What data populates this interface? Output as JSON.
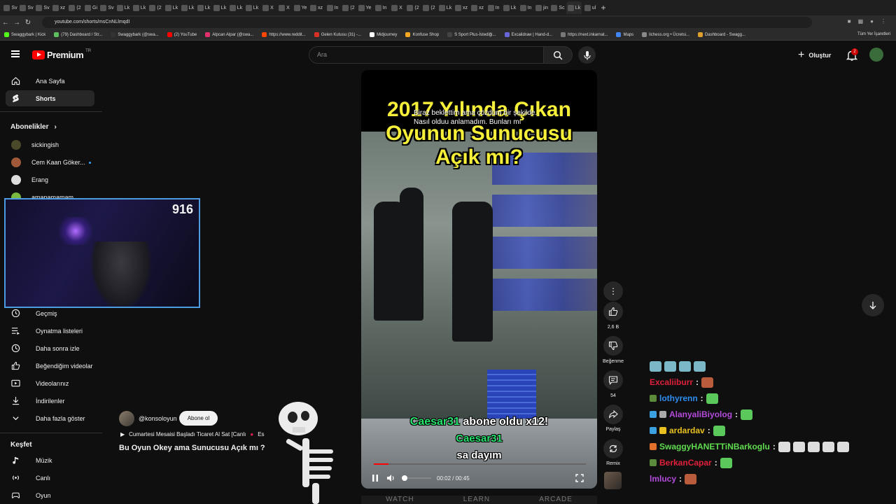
{
  "browser": {
    "tabs": [
      "Sv",
      "Sv",
      "Sv",
      "xz",
      "(2",
      "Gi",
      "Sv",
      "Lk",
      "Lk",
      "(2",
      "Lk",
      "Lk",
      "Lk",
      "Lk",
      "Lk",
      "Lk",
      "X",
      "X",
      "Ye",
      "xz",
      "In",
      "(2",
      "Ye",
      "In",
      "X",
      "(2",
      "(2",
      "Lk",
      "xz",
      "xz",
      "In",
      "Lk",
      "In",
      "jin",
      "Sc",
      "Lk",
      "ul"
    ],
    "url": "youtube.com/shorts/msCnNLlmqdI",
    "bookmarks": [
      "Swaggybark | Kick",
      "(79) Dashboard / Str...",
      "Swaggybark (@swa...",
      "(2) YouTube",
      "Alpcan Alpar (@swa...",
      "https://www.reddit...",
      "Gelen Kutusu (31) -...",
      "Midjourney",
      "Konfuse Shop",
      "S Sport Plus-İstediği...",
      "Excalidraw | Hand-d...",
      "https://next.inkarnat...",
      "Maps",
      "lichess.org • Ücretsi...",
      "Dashboard - Swagg..."
    ],
    "bookmarks_right": "Tüm Yer İşaretleri"
  },
  "header": {
    "logo": "Premium",
    "region": "TR",
    "search_placeholder": "Ara",
    "create_label": "Oluştur",
    "notif_count": "2"
  },
  "sidebar": {
    "home": "Ana Sayfa",
    "shorts": "Shorts",
    "subs_heading": "Abonelikler",
    "channels": [
      "sickingish",
      "Cem Kaan Göker...",
      "Erang",
      "amapamamam"
    ],
    "history": "Geçmiş",
    "playlists": "Oynatma listeleri",
    "watch_later": "Daha sonra izle",
    "liked": "Beğendiğim videolar",
    "your_videos": "Videolarınız",
    "downloads": "İndirilenler",
    "show_more": "Daha fazla göster",
    "explore_heading": "Keşfet",
    "music": "Müzik",
    "live": "Canlı",
    "gaming": "Oyun"
  },
  "webcam": {
    "viewer_count": "916"
  },
  "video": {
    "overlay_title": "2017 Yılında Çıkan Oyunun Sunucusu Açık mı?",
    "subtitle_1": "Biraz beklettim ama çözdüm bir şekilde.",
    "subtitle_2": "Nasıl olduu anlamadım. Bunları mı",
    "alert_user": "Caesar31",
    "alert_text": "abone oldu x12!",
    "alert_user_2": "Caesar31",
    "alert_message": "sa dayım",
    "time": "00:02 / 00:45",
    "progress": 0.07
  },
  "rail": {
    "likes": "2,6 B",
    "dislike": "Beğenme",
    "comments": "54",
    "share": "Paylaş",
    "remix": "Remix"
  },
  "channel": {
    "name": "@konsoloyun",
    "subscribe": "Abone ol",
    "live_text": "Cumartesi Mesaisi Başladı Ticaret Al Sat [Canlı",
    "live_text_tail": "Es",
    "title": "Bu Oyun Okey ama Sunucusu Açık mı ?"
  },
  "chat": [
    {
      "user": "Excaliiburr",
      "color": "#e0203a"
    },
    {
      "user": "lothyrenn",
      "color": "#2e8ef0"
    },
    {
      "user": "AlanyaliBiyolog",
      "color": "#b34bdb"
    },
    {
      "user": "ardardav",
      "color": "#e8c020"
    },
    {
      "user": "SwaggyHANETTiNBarkoglu",
      "color": "#5fdc4f"
    },
    {
      "user": "BerkanCapar",
      "color": "#e0203a"
    },
    {
      "user": "lmlucy",
      "color": "#b34bdb"
    }
  ],
  "bottom_strip": [
    "WATCH",
    "LEARN",
    "ARCADE"
  ]
}
